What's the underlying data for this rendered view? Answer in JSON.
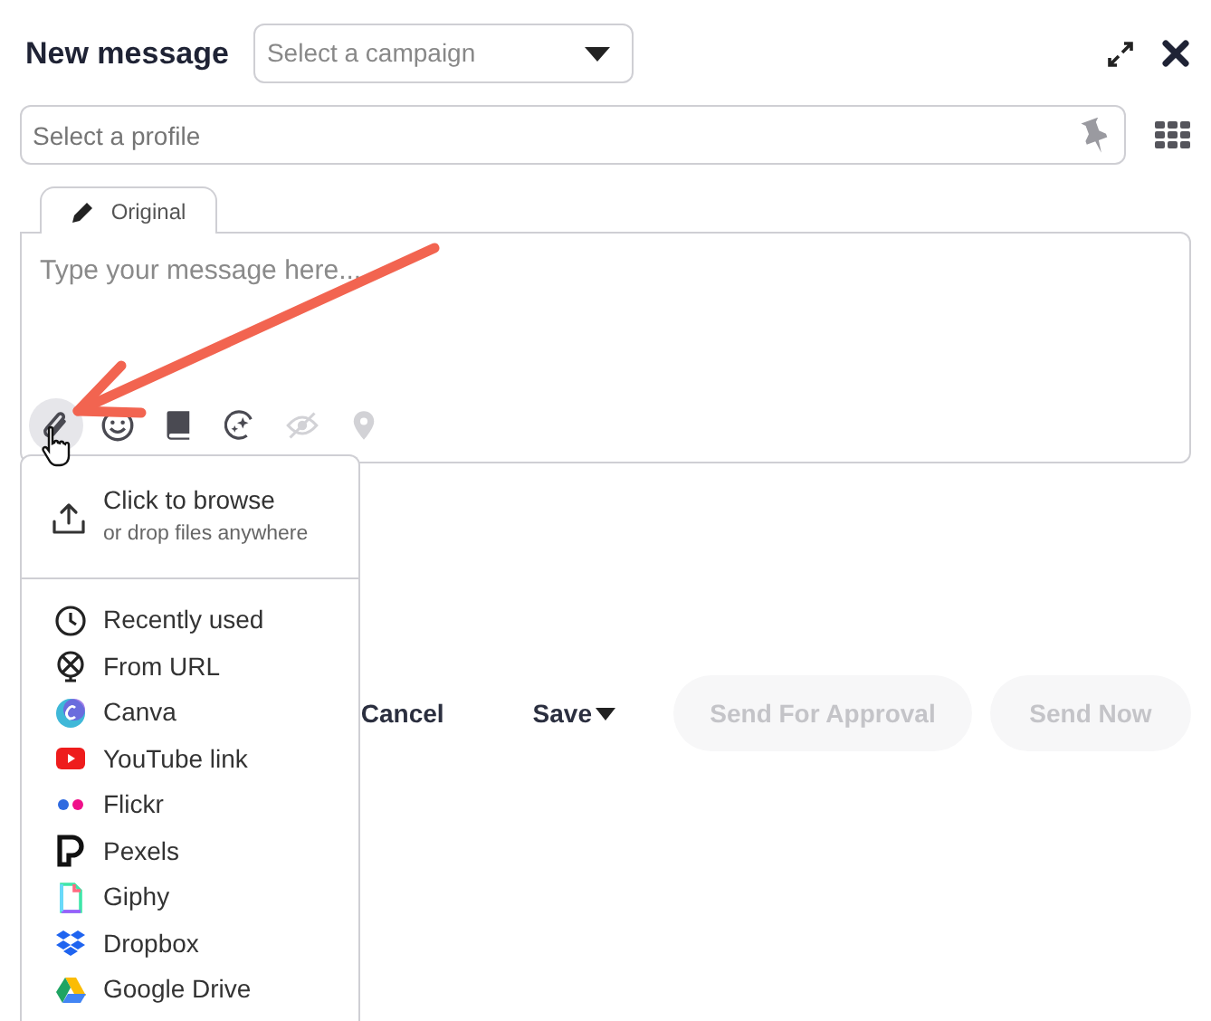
{
  "header": {
    "title": "New message",
    "campaign_select": {
      "placeholder": "Select a campaign"
    }
  },
  "profile_field": {
    "placeholder": "Select a profile"
  },
  "editor_tabs": [
    {
      "label": "Original",
      "selected": true
    }
  ],
  "message": {
    "placeholder": "Type your message here..."
  },
  "toolbar": [
    {
      "kind": "attach",
      "selected": true,
      "disabled": false
    },
    {
      "kind": "emoji",
      "selected": false,
      "disabled": false
    },
    {
      "kind": "library",
      "selected": false,
      "disabled": false
    },
    {
      "kind": "ai",
      "selected": false,
      "disabled": false
    },
    {
      "kind": "preview",
      "selected": false,
      "disabled": true
    },
    {
      "kind": "location",
      "selected": false,
      "disabled": true
    }
  ],
  "attach_menu": {
    "browse": {
      "title": "Click to browse",
      "subtitle": "or drop files anywhere"
    },
    "sources": [
      {
        "kind": "recent",
        "label": "Recently used"
      },
      {
        "kind": "url",
        "label": "From URL"
      },
      {
        "kind": "canva",
        "label": "Canva"
      },
      {
        "kind": "youtube",
        "label": "YouTube link"
      },
      {
        "kind": "flickr",
        "label": "Flickr"
      },
      {
        "kind": "pexels",
        "label": "Pexels"
      },
      {
        "kind": "giphy",
        "label": "Giphy"
      },
      {
        "kind": "dropbox",
        "label": "Dropbox"
      },
      {
        "kind": "gdrive",
        "label": "Google Drive"
      }
    ]
  },
  "actions": [
    {
      "kind": "plain",
      "label": "Cancel",
      "disabled": false
    },
    {
      "kind": "dropdown",
      "label": "Save",
      "disabled": false
    },
    {
      "kind": "pill",
      "label": "Send For Approval",
      "disabled": true
    },
    {
      "kind": "pill",
      "label": "Send Now",
      "disabled": true
    }
  ]
}
